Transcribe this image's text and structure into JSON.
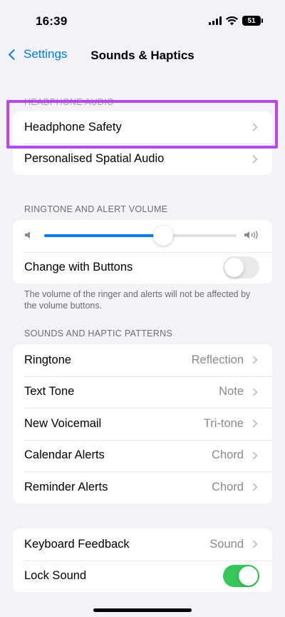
{
  "status_bar": {
    "time": "16:39",
    "battery": "51"
  },
  "nav": {
    "back_label": "Settings",
    "title": "Sounds & Haptics"
  },
  "headphone_audio": {
    "header": "HEADPHONE AUDIO",
    "items": [
      {
        "label": "Headphone Safety"
      },
      {
        "label": "Personalised Spatial Audio"
      }
    ]
  },
  "ringtone_volume": {
    "header": "RINGTONE AND ALERT VOLUME",
    "volume_level": 0.62,
    "change_with_buttons": {
      "label": "Change with Buttons",
      "on": false
    },
    "footer": "The volume of the ringer and alerts will not be affected by the volume buttons."
  },
  "patterns": {
    "header": "SOUNDS AND HAPTIC PATTERNS",
    "items": [
      {
        "label": "Ringtone",
        "value": "Reflection"
      },
      {
        "label": "Text Tone",
        "value": "Note"
      },
      {
        "label": "New Voicemail",
        "value": "Tri-tone"
      },
      {
        "label": "Calendar Alerts",
        "value": "Chord"
      },
      {
        "label": "Reminder Alerts",
        "value": "Chord"
      }
    ]
  },
  "system": {
    "keyboard_feedback": {
      "label": "Keyboard Feedback",
      "value": "Sound"
    },
    "lock_sound": {
      "label": "Lock Sound",
      "on": true
    }
  },
  "colors": {
    "accent": "#007aff",
    "toggle_on": "#34c759",
    "highlight": "#b946f4"
  }
}
